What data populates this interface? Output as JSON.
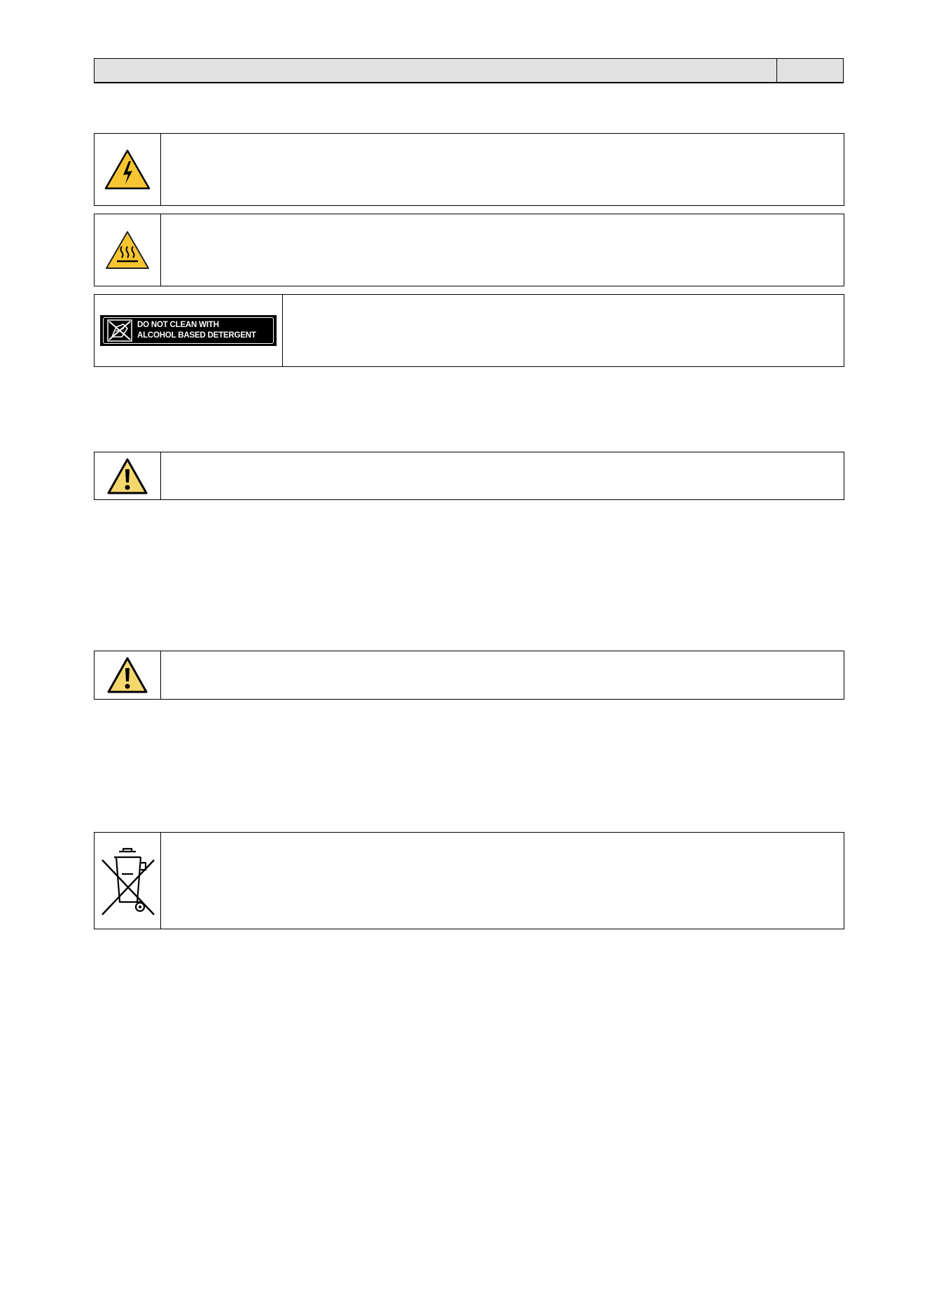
{
  "header": {
    "title": "",
    "page": ""
  },
  "warnings": {
    "electric": {
      "icon": "electric-hazard-icon",
      "text": ""
    },
    "hot_surface": {
      "icon": "hot-surface-icon",
      "text": ""
    },
    "alcohol": {
      "icon": "no-alcohol-cleaning-icon",
      "label_line1": "DO NOT CLEAN WITH",
      "label_line2": "ALCOHOL BASED DETERGENT",
      "text": ""
    },
    "caution_1": {
      "icon": "caution-exclamation-icon",
      "text": ""
    },
    "caution_2": {
      "icon": "caution-exclamation-icon",
      "text": ""
    },
    "weee": {
      "icon": "crossed-out-wheelie-bin-icon",
      "text": ""
    }
  },
  "colors": {
    "header_fill": "#e2e2e2",
    "warning_yellow": "#f7c531",
    "caution_yellow": "#f5d76e",
    "border": "#000000"
  }
}
